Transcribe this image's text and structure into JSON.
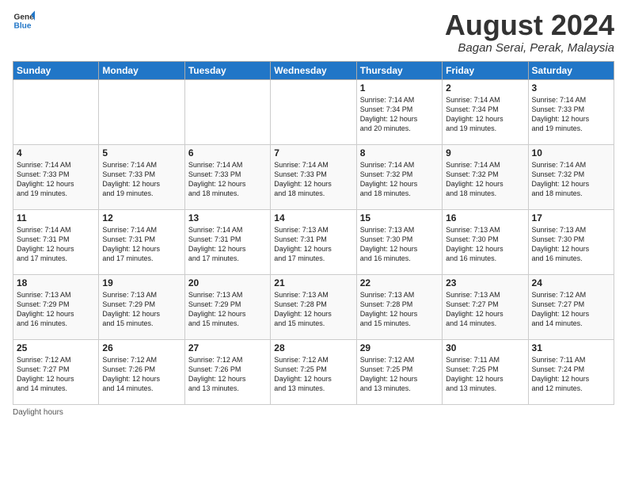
{
  "header": {
    "logo_line1": "General",
    "logo_line2": "Blue",
    "month_title": "August 2024",
    "location": "Bagan Serai, Perak, Malaysia"
  },
  "days_of_week": [
    "Sunday",
    "Monday",
    "Tuesday",
    "Wednesday",
    "Thursday",
    "Friday",
    "Saturday"
  ],
  "footer_label": "Daylight hours",
  "weeks": [
    [
      {
        "day": "",
        "info": ""
      },
      {
        "day": "",
        "info": ""
      },
      {
        "day": "",
        "info": ""
      },
      {
        "day": "",
        "info": ""
      },
      {
        "day": "1",
        "info": "Sunrise: 7:14 AM\nSunset: 7:34 PM\nDaylight: 12 hours\nand 20 minutes."
      },
      {
        "day": "2",
        "info": "Sunrise: 7:14 AM\nSunset: 7:34 PM\nDaylight: 12 hours\nand 19 minutes."
      },
      {
        "day": "3",
        "info": "Sunrise: 7:14 AM\nSunset: 7:33 PM\nDaylight: 12 hours\nand 19 minutes."
      }
    ],
    [
      {
        "day": "4",
        "info": "Sunrise: 7:14 AM\nSunset: 7:33 PM\nDaylight: 12 hours\nand 19 minutes."
      },
      {
        "day": "5",
        "info": "Sunrise: 7:14 AM\nSunset: 7:33 PM\nDaylight: 12 hours\nand 19 minutes."
      },
      {
        "day": "6",
        "info": "Sunrise: 7:14 AM\nSunset: 7:33 PM\nDaylight: 12 hours\nand 18 minutes."
      },
      {
        "day": "7",
        "info": "Sunrise: 7:14 AM\nSunset: 7:33 PM\nDaylight: 12 hours\nand 18 minutes."
      },
      {
        "day": "8",
        "info": "Sunrise: 7:14 AM\nSunset: 7:32 PM\nDaylight: 12 hours\nand 18 minutes."
      },
      {
        "day": "9",
        "info": "Sunrise: 7:14 AM\nSunset: 7:32 PM\nDaylight: 12 hours\nand 18 minutes."
      },
      {
        "day": "10",
        "info": "Sunrise: 7:14 AM\nSunset: 7:32 PM\nDaylight: 12 hours\nand 18 minutes."
      }
    ],
    [
      {
        "day": "11",
        "info": "Sunrise: 7:14 AM\nSunset: 7:31 PM\nDaylight: 12 hours\nand 17 minutes."
      },
      {
        "day": "12",
        "info": "Sunrise: 7:14 AM\nSunset: 7:31 PM\nDaylight: 12 hours\nand 17 minutes."
      },
      {
        "day": "13",
        "info": "Sunrise: 7:14 AM\nSunset: 7:31 PM\nDaylight: 12 hours\nand 17 minutes."
      },
      {
        "day": "14",
        "info": "Sunrise: 7:13 AM\nSunset: 7:31 PM\nDaylight: 12 hours\nand 17 minutes."
      },
      {
        "day": "15",
        "info": "Sunrise: 7:13 AM\nSunset: 7:30 PM\nDaylight: 12 hours\nand 16 minutes."
      },
      {
        "day": "16",
        "info": "Sunrise: 7:13 AM\nSunset: 7:30 PM\nDaylight: 12 hours\nand 16 minutes."
      },
      {
        "day": "17",
        "info": "Sunrise: 7:13 AM\nSunset: 7:30 PM\nDaylight: 12 hours\nand 16 minutes."
      }
    ],
    [
      {
        "day": "18",
        "info": "Sunrise: 7:13 AM\nSunset: 7:29 PM\nDaylight: 12 hours\nand 16 minutes."
      },
      {
        "day": "19",
        "info": "Sunrise: 7:13 AM\nSunset: 7:29 PM\nDaylight: 12 hours\nand 15 minutes."
      },
      {
        "day": "20",
        "info": "Sunrise: 7:13 AM\nSunset: 7:29 PM\nDaylight: 12 hours\nand 15 minutes."
      },
      {
        "day": "21",
        "info": "Sunrise: 7:13 AM\nSunset: 7:28 PM\nDaylight: 12 hours\nand 15 minutes."
      },
      {
        "day": "22",
        "info": "Sunrise: 7:13 AM\nSunset: 7:28 PM\nDaylight: 12 hours\nand 15 minutes."
      },
      {
        "day": "23",
        "info": "Sunrise: 7:13 AM\nSunset: 7:27 PM\nDaylight: 12 hours\nand 14 minutes."
      },
      {
        "day": "24",
        "info": "Sunrise: 7:12 AM\nSunset: 7:27 PM\nDaylight: 12 hours\nand 14 minutes."
      }
    ],
    [
      {
        "day": "25",
        "info": "Sunrise: 7:12 AM\nSunset: 7:27 PM\nDaylight: 12 hours\nand 14 minutes."
      },
      {
        "day": "26",
        "info": "Sunrise: 7:12 AM\nSunset: 7:26 PM\nDaylight: 12 hours\nand 14 minutes."
      },
      {
        "day": "27",
        "info": "Sunrise: 7:12 AM\nSunset: 7:26 PM\nDaylight: 12 hours\nand 13 minutes."
      },
      {
        "day": "28",
        "info": "Sunrise: 7:12 AM\nSunset: 7:25 PM\nDaylight: 12 hours\nand 13 minutes."
      },
      {
        "day": "29",
        "info": "Sunrise: 7:12 AM\nSunset: 7:25 PM\nDaylight: 12 hours\nand 13 minutes."
      },
      {
        "day": "30",
        "info": "Sunrise: 7:11 AM\nSunset: 7:25 PM\nDaylight: 12 hours\nand 13 minutes."
      },
      {
        "day": "31",
        "info": "Sunrise: 7:11 AM\nSunset: 7:24 PM\nDaylight: 12 hours\nand 12 minutes."
      }
    ]
  ]
}
